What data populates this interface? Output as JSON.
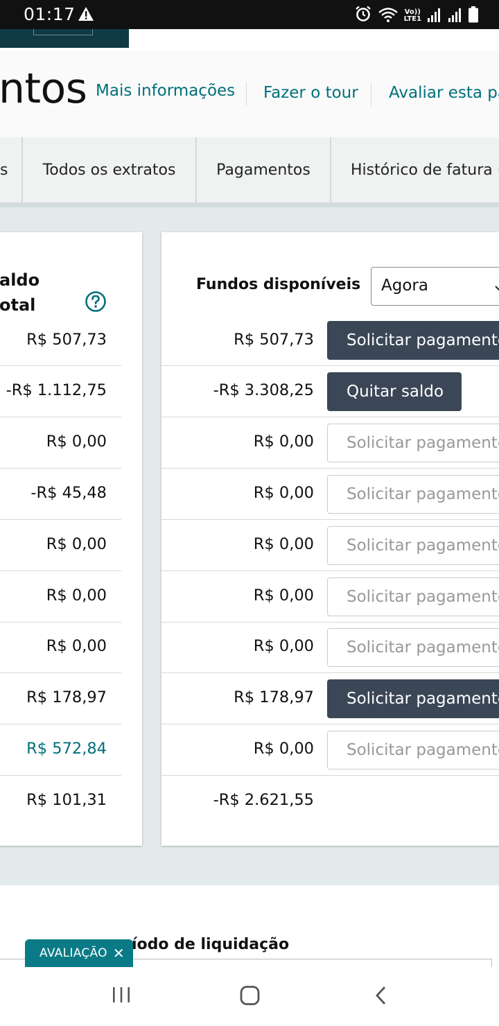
{
  "status_bar": {
    "time": "01:17",
    "network_label_top": "Vo))",
    "network_label_bottom": "LTE1"
  },
  "header": {
    "title": "ntos",
    "links": [
      "Mais informações",
      "Fazer o tour",
      "Avaliar esta pá"
    ]
  },
  "tabs": [
    "s",
    "Todos os extratos",
    "Pagamentos",
    "Histórico de fatura"
  ],
  "table": {
    "left_column_title_line1": "aldo",
    "left_column_title_line2": "otal",
    "right_column_title": "Fundos disponíveis",
    "period_select_value": "Agora",
    "rows": [
      {
        "total": "R$ 507,73",
        "available": "R$ 507,73",
        "action": "Solicitar pagamento",
        "action_style": "primary"
      },
      {
        "total": "-R$ 1.112,75",
        "available": "-R$ 3.308,25",
        "action": "Quitar saldo",
        "action_style": "primary"
      },
      {
        "total": "R$ 0,00",
        "available": "R$ 0,00",
        "action": "Solicitar pagamento",
        "action_style": "disabled"
      },
      {
        "total": "-R$ 45,48",
        "available": "R$ 0,00",
        "action": "Solicitar pagamento",
        "action_style": "disabled"
      },
      {
        "total": "R$ 0,00",
        "available": "R$ 0,00",
        "action": "Solicitar pagamento",
        "action_style": "disabled"
      },
      {
        "total": "R$ 0,00",
        "available": "R$ 0,00",
        "action": "Solicitar pagamento",
        "action_style": "disabled"
      },
      {
        "total": "R$ 0,00",
        "available": "R$ 0,00",
        "action": "Solicitar pagamento",
        "action_style": "disabled"
      },
      {
        "total": "R$ 178,97",
        "available": "R$ 178,97",
        "action": "Solicitar pagamento",
        "action_style": "primary"
      },
      {
        "total": "R$ 572,84",
        "available": "R$ 0,00",
        "action": "Solicitar pagamento",
        "action_style": "disabled",
        "total_link": true
      },
      {
        "total": "R$ 101,31",
        "available": "-R$ 2.621,55"
      }
    ]
  },
  "bottom_section": {
    "title": "íodo de liquidação"
  },
  "feedback_tab": {
    "label": "AVALIAÇÃO",
    "close": "✕"
  },
  "colors": {
    "accent_teal": "#00707a",
    "button_dark": "#3b4656",
    "panel_bg": "#e3eaeb"
  }
}
